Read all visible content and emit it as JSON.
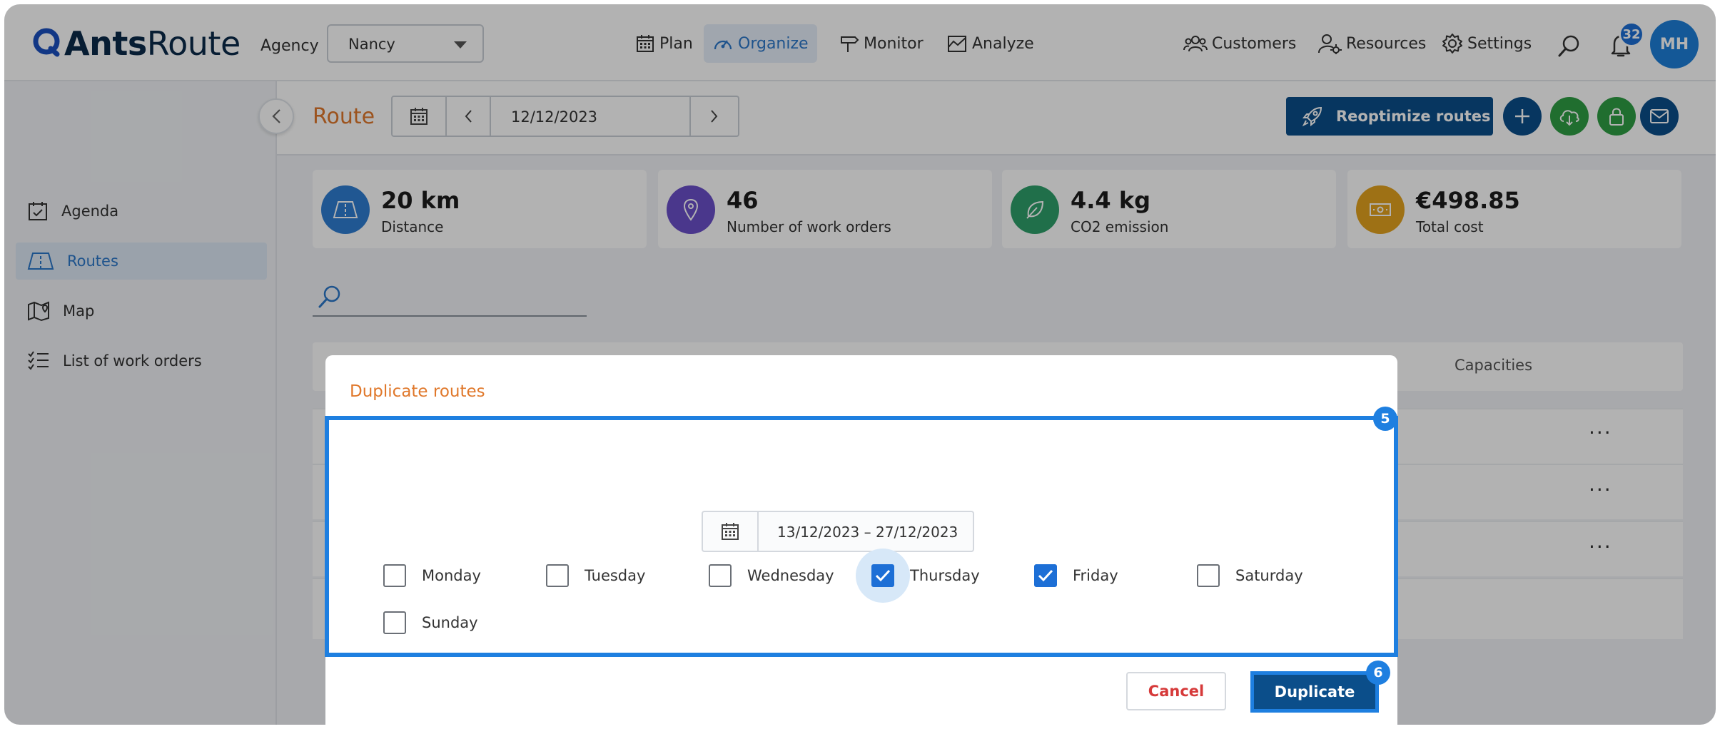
{
  "header": {
    "logo_bold": "Ants",
    "logo_rest": "Route",
    "agency_label": "Agency",
    "agency_value": "Nancy",
    "nav": [
      {
        "label": "Plan",
        "icon": "calendar-icon"
      },
      {
        "label": "Organize",
        "icon": "gauge-icon",
        "active": true
      },
      {
        "label": "Monitor",
        "icon": "signpost-icon"
      },
      {
        "label": "Analyze",
        "icon": "chart-icon"
      }
    ],
    "right_nav": [
      {
        "label": "Customers",
        "icon": "users-icon"
      },
      {
        "label": "Resources",
        "icon": "user-gear-icon"
      },
      {
        "label": "Settings",
        "icon": "gear-icon"
      }
    ],
    "notification_count": "32",
    "avatar_initials": "MH"
  },
  "subheader": {
    "title": "Route",
    "date": "12/12/2023",
    "reoptimize_label": "Reoptimize routes"
  },
  "sidebar": {
    "items": [
      {
        "label": "Agenda",
        "icon": "agenda-icon"
      },
      {
        "label": "Routes",
        "icon": "routes-icon",
        "active": true
      },
      {
        "label": "Map",
        "icon": "map-icon"
      },
      {
        "label": "List of work orders",
        "icon": "list-icon"
      }
    ]
  },
  "stats": [
    {
      "value": "20 km",
      "label": "Distance",
      "icon": "road-icon",
      "color": "#2f7dd1"
    },
    {
      "value": "46",
      "label": "Number of work orders",
      "icon": "pin-icon",
      "color": "#6a4fc9"
    },
    {
      "value": "4.4 kg",
      "label": "CO2 emission",
      "icon": "leaf-icon",
      "color": "#2fa06b"
    },
    {
      "value": "€498.85",
      "label": "Total cost",
      "icon": "banknote-icon",
      "color": "#e3a21f"
    }
  ],
  "table": {
    "capacities_header": "Capacities",
    "row_menu": "···"
  },
  "modal": {
    "title": "Duplicate routes",
    "date_range": "13/12/2023 – 27/12/2023",
    "days": [
      {
        "label": "Monday",
        "checked": false
      },
      {
        "label": "Tuesday",
        "checked": false
      },
      {
        "label": "Wednesday",
        "checked": false
      },
      {
        "label": "Thursday",
        "checked": true
      },
      {
        "label": "Friday",
        "checked": true
      },
      {
        "label": "Saturday",
        "checked": false
      },
      {
        "label": "Sunday",
        "checked": false
      }
    ],
    "cancel_label": "Cancel",
    "duplicate_label": "Duplicate",
    "step_badge_area": "5",
    "step_badge_button": "6"
  },
  "colors": {
    "accent": "#e0782b",
    "primary": "#0b4e8a",
    "highlight": "#1e7fe0",
    "checkbox": "#1d6fd6"
  }
}
